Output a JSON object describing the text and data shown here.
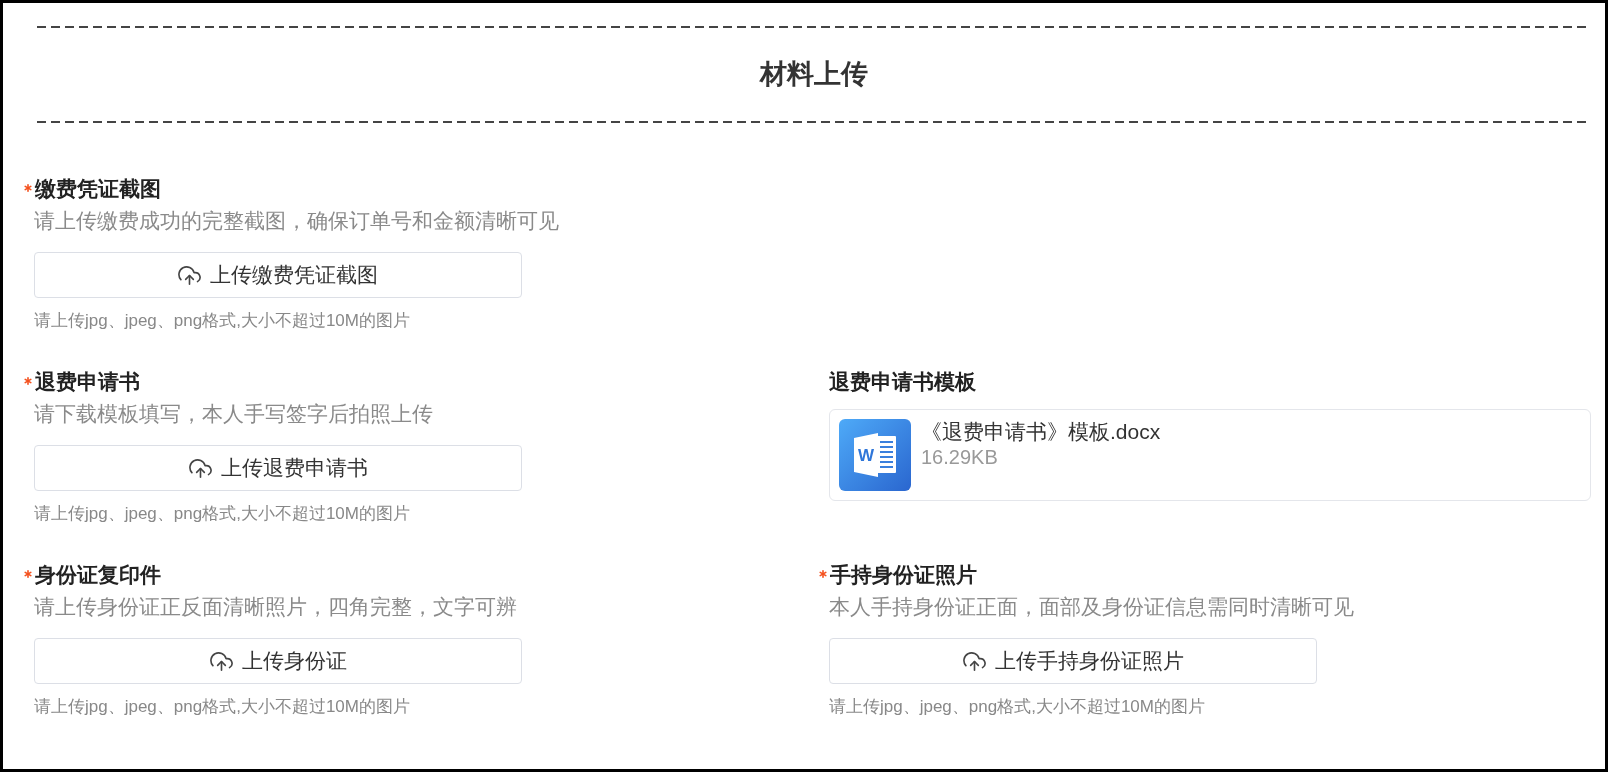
{
  "header": {
    "title": "材料上传"
  },
  "rows": [
    {
      "items": [
        {
          "kind": "upload",
          "required": true,
          "label": "缴费凭证截图",
          "description": "请上传缴费成功的完整截图，确保订单号和金额清晰可见",
          "button": "上传缴费凭证截图",
          "hint": "请上传jpg、jpeg、png格式,大小不超过10M的图片"
        }
      ]
    },
    {
      "items": [
        {
          "kind": "upload",
          "required": true,
          "label": "退费申请书",
          "description": "请下载模板填写，本人手写签字后拍照上传",
          "button": "上传退费申请书",
          "hint": "请上传jpg、jpeg、png格式,大小不超过10M的图片"
        },
        {
          "kind": "template",
          "required": false,
          "label": "退费申请书模板",
          "file": {
            "icon_letter": "W",
            "name": "《退费申请书》模板.docx",
            "size": "16.29KB"
          }
        }
      ]
    },
    {
      "items": [
        {
          "kind": "upload",
          "required": true,
          "label": "身份证复印件",
          "description": "请上传身份证正反面清晰照片，四角完整，文字可辨",
          "button": "上传身份证",
          "hint": "请上传jpg、jpeg、png格式,大小不超过10M的图片"
        },
        {
          "kind": "upload",
          "required": true,
          "label": "手持身份证照片",
          "description": "本人手持身份证正面，面部及身份证信息需同时清晰可见",
          "button": "上传手持身份证照片",
          "hint": "请上传jpg、jpeg、png格式,大小不超过10M的图片"
        }
      ]
    }
  ]
}
